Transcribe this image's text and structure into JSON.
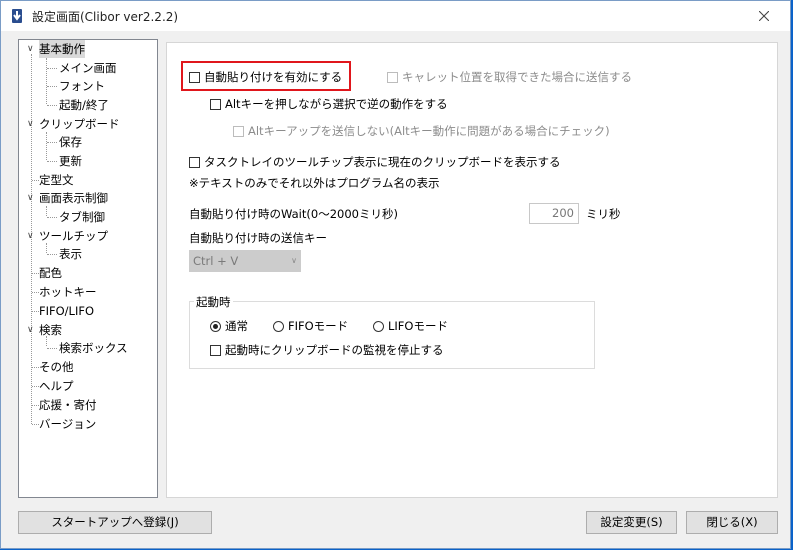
{
  "window": {
    "title": "設定画面(Clibor ver2.2.2)"
  },
  "tree": [
    {
      "label": "基本動作",
      "selected": true
    },
    {
      "label": "メイン画面"
    },
    {
      "label": "フォント"
    },
    {
      "label": "起動/終了"
    },
    {
      "label": "クリップボード"
    },
    {
      "label": "保存"
    },
    {
      "label": "更新"
    },
    {
      "label": "定型文"
    },
    {
      "label": "画面表示制御"
    },
    {
      "label": "タブ制御"
    },
    {
      "label": "ツールチップ"
    },
    {
      "label": "表示"
    },
    {
      "label": "配色"
    },
    {
      "label": "ホットキー"
    },
    {
      "label": "FIFO/LIFO"
    },
    {
      "label": "検索"
    },
    {
      "label": "検索ボックス"
    },
    {
      "label": "その他"
    },
    {
      "label": "ヘルプ"
    },
    {
      "label": "応援・寄付"
    },
    {
      "label": "バージョン"
    }
  ],
  "panel": {
    "auto_paste": "自動貼り付けを有効にする",
    "caret": "キャレット位置を取得できた場合に送信する",
    "alt_reverse": "Altキーを押しながら選択で逆の動作をする",
    "alt_up": "Altキーアップを送信しない(Altキー動作に問題がある場合にチェック)",
    "tasktray": "タスクトレイのツールチップ表示に現在のクリップボードを表示する",
    "note": "※テキストのみでそれ以外はプログラム名の表示",
    "wait_label": "自動貼り付け時のWait(0～2000ミリ秒)",
    "wait_value": "200",
    "wait_unit": "ミリ秒",
    "send_key_label": "自動貼り付け時の送信キー",
    "send_key_value": "Ctrl + V",
    "startup_title": "起動時",
    "mode_normal": "通常",
    "mode_fifo": "FIFOモード",
    "mode_lifo": "LIFOモード",
    "stop_monitor": "起動時にクリップボードの監視を停止する"
  },
  "buttons": {
    "startup": "スタートアップへ登録(J)",
    "apply": "設定変更(S)",
    "close": "閉じる(X)"
  },
  "colors": {
    "highlight": "#e0161c",
    "desktop": "#0a62c9"
  }
}
